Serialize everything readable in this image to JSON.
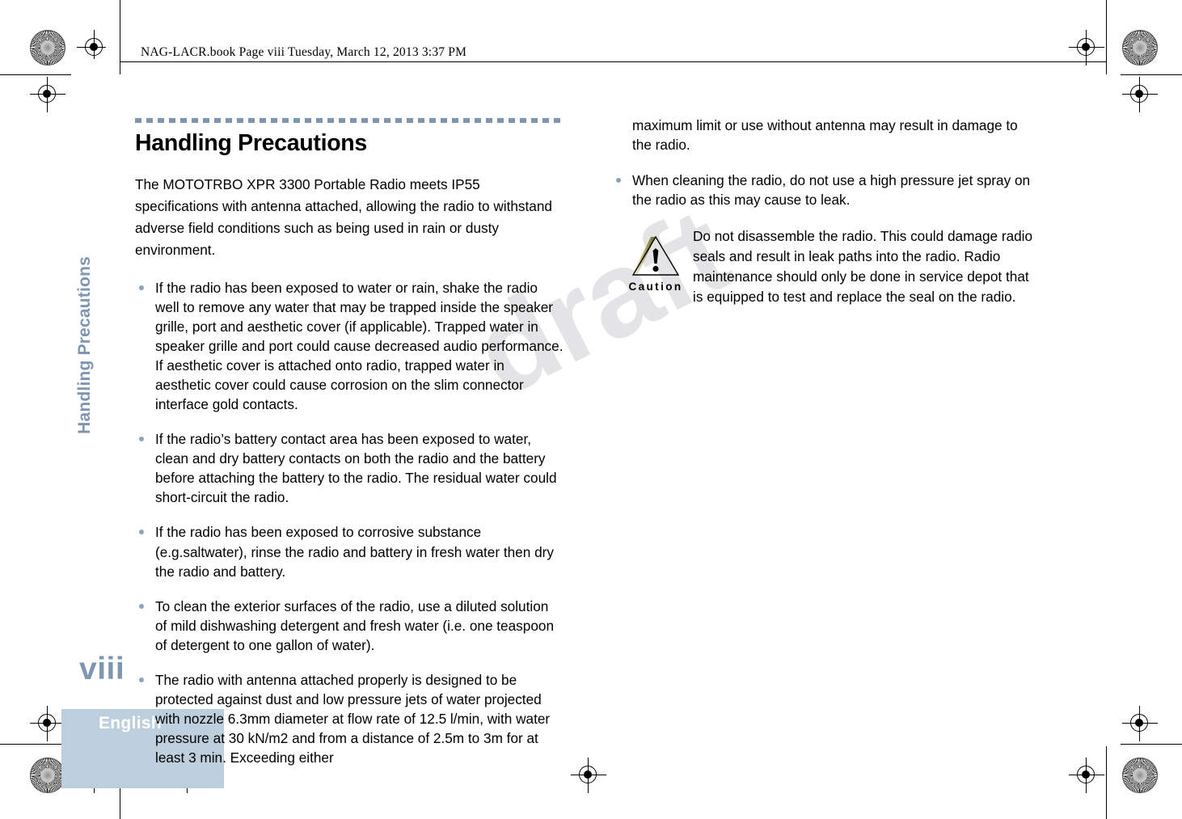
{
  "header": {
    "slug": "NAG-LACR.book  Page viii  Tuesday, March 12, 2013  3:37 PM"
  },
  "watermark": {
    "text": "draft"
  },
  "sidebar": {
    "chapter_label": "Handling Precautions",
    "page_number": "viii",
    "language_tab": "English",
    "tab_color": "#bdcedd",
    "accent_color": "#7e96b2"
  },
  "main": {
    "title": "Handling Precautions",
    "intro": "The MOTOTRBO XPR 3300 Portable Radio meets IP55 specifications with antenna attached, allowing the radio to withstand adverse field conditions such as being used in rain or dusty environment.",
    "bullets_left": [
      "If the radio has been exposed to water or rain, shake the radio well to remove any water that may be trapped inside the speaker grille,  port and aesthetic cover (if applicable). Trapped water in speaker grille and  port could cause decreased audio performance. If aesthetic cover is attached onto radio, trapped water in aesthetic cover could cause corrosion on the slim connector interface gold contacts.",
      "If the radio’s battery contact area has been exposed to water, clean and dry battery contacts on both the radio and the battery before attaching the battery to the radio. The residual water could short-circuit the radio.",
      "If the radio has been exposed to corrosive substance (e.g.saltwater), rinse the radio and battery in fresh water then dry the radio and battery.",
      "To clean the exterior surfaces of the radio, use a diluted solution of mild dishwashing detergent and fresh water (i.e. one teaspoon of detergent to one gallon of water).",
      "The radio with antenna attached properly is designed to be protected against dust and low pressure jets of water projected with nozzle 6.3mm diameter at flow rate of 12.5 l/min, with water pressure at 30 kN/m2 and from a distance of 2.5m to 3m for at least 3 min. Exceeding either"
    ],
    "continuation_right": "maximum limit or use without antenna may result in damage to the radio.",
    "bullets_right": [
      "When cleaning the radio, do not use a high pressure jet spray on the radio as this may cause to leak."
    ],
    "caution": {
      "label": "Caution",
      "text": "Do not disassemble the radio. This could damage radio seals and result in leak paths into the radio. Radio maintenance should only be done in service depot that is equipped to test and replace the seal on the radio."
    }
  }
}
